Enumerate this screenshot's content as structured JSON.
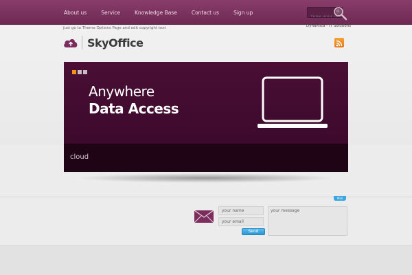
{
  "nav": {
    "items": [
      "About us",
      "Service",
      "Knowledge Base",
      "Contact us",
      "Sign up"
    ]
  },
  "search": {
    "placeholder": "type your search"
  },
  "brand": {
    "name": "SkyOffice"
  },
  "hero": {
    "headline_line1": "Anywhere",
    "headline_line2": "Data Access",
    "caption": "cloud",
    "slide_count": 3,
    "active_slide": 1
  },
  "contact": {
    "tab_label": "Mail",
    "name_placeholder": "your name",
    "email_placeholder": "your email",
    "message_placeholder": "your message",
    "send_label": "Send"
  },
  "footer": {
    "copyright": "Just go to Theme Options Page and edit copyright text",
    "credit": "Dynamica - IT Solutions"
  },
  "colors": {
    "brand": "#7a3060",
    "hero_bg": "#420c2f",
    "accent_orange": "#f3901c",
    "button_blue": "#3aa6dd"
  }
}
